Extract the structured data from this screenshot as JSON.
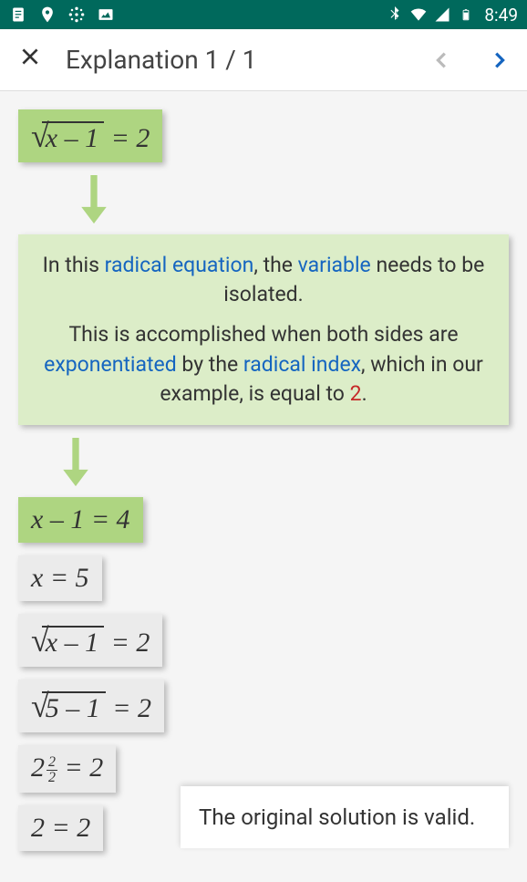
{
  "status": {
    "time": "8:49"
  },
  "header": {
    "title": "Explanation 1 / 1",
    "prev": "‹",
    "next": "›"
  },
  "eq1": {
    "arg": "x – 1",
    "rhs": " = 2"
  },
  "explain": {
    "p1a": "In this ",
    "t1": "radical equation",
    "p1b": ", the ",
    "t2": "variable",
    "p1c": " needs to be isolated.",
    "p2a": "This is accomplished when both sides are ",
    "t3": "exponentiated",
    "p2b": " by the ",
    "t4": "radical index",
    "p2c": ", which in our example, is equal to ",
    "num": "2",
    "p2d": "."
  },
  "eq2": "x – 1 = 4",
  "eq3": "x = 5",
  "eq4": {
    "arg": "x – 1",
    "rhs": " = 2"
  },
  "eq5": {
    "arg": "5 – 1",
    "rhs": " = 2"
  },
  "eq6": {
    "base": "2",
    "ftop": "2",
    "fbot": "2",
    "rhs": " = 2"
  },
  "eq7": "2 = 2",
  "note": "The original solution is valid."
}
